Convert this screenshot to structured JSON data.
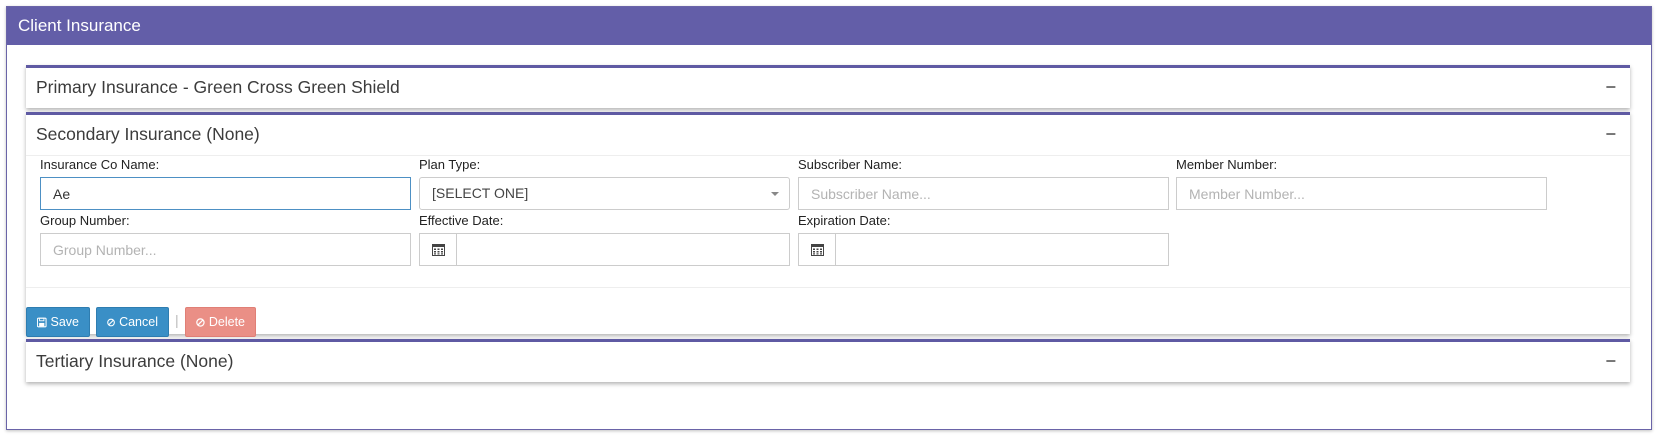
{
  "window": {
    "title": "Client Insurance"
  },
  "panels": {
    "primary": {
      "title": "Primary Insurance - Green Cross Green Shield",
      "toggle": "−"
    },
    "secondary": {
      "title": "Secondary Insurance (None)",
      "toggle": "−"
    },
    "tertiary": {
      "title": "Tertiary Insurance (None)",
      "toggle": "−"
    }
  },
  "form": {
    "insurance_co_name": {
      "label": "Insurance Co Name:",
      "value": "Ae",
      "placeholder": ""
    },
    "plan_type": {
      "label": "Plan Type:",
      "value": "[SELECT ONE]"
    },
    "subscriber_name": {
      "label": "Subscriber Name:",
      "value": "",
      "placeholder": "Subscriber Name..."
    },
    "member_number": {
      "label": "Member Number:",
      "value": "",
      "placeholder": "Member Number..."
    },
    "group_number": {
      "label": "Group Number:",
      "value": "",
      "placeholder": "Group Number..."
    },
    "effective_date": {
      "label": "Effective Date:",
      "value": ""
    },
    "expiration_date": {
      "label": "Expiration Date:",
      "value": ""
    }
  },
  "actions": {
    "save": "Save",
    "cancel": "Cancel",
    "separator": "|",
    "delete": "Delete"
  },
  "colors": {
    "header": "#635ea8",
    "panel_accent": "#5f5aa3",
    "primary_button": "#3a8fc6",
    "danger_button": "#ea8f86"
  },
  "icons": {
    "save": "floppy-disk-icon",
    "cancel": "ban-icon",
    "delete": "ban-icon",
    "date": "calendar-icon"
  }
}
